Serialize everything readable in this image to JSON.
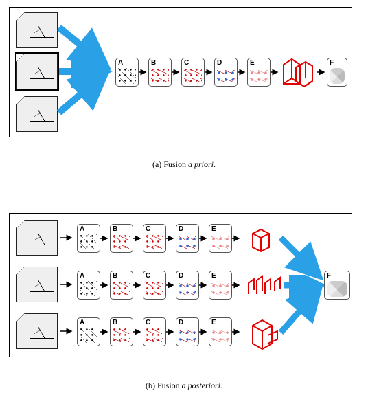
{
  "panelA": {
    "caption_enum": "(a)",
    "caption_plain": "Fusion ",
    "caption_italic": "a priori",
    "caption_end": ".",
    "thumbs": [
      "input-1",
      "input-2",
      "input-3"
    ],
    "stages": {
      "A": "A",
      "B": "B",
      "C": "C",
      "D": "D",
      "E": "E",
      "F": "F"
    }
  },
  "panelB": {
    "caption_enum": "(b)",
    "caption_plain": "Fusion ",
    "caption_italic": "a posteriori",
    "caption_end": ".",
    "rows": 3,
    "stages": {
      "A": "A",
      "B": "B",
      "C": "C",
      "D": "D",
      "E": "E",
      "F": "F"
    }
  },
  "chart_data": {
    "type": "diagram",
    "title": "",
    "subfigures": [
      {
        "label": "(a) Fusion a priori",
        "inputs": 3,
        "fusion_point": "before pipeline (after inputs merge into single A)",
        "pipeline": [
          "A",
          "B",
          "C",
          "D",
          "E",
          "3D-reconstruction",
          "F"
        ],
        "arrows": {
          "input_to_A": {
            "count": 3,
            "color": "blue",
            "style": "thick"
          },
          "stage_to_stage": {
            "color": "black",
            "style": "thin"
          }
        }
      },
      {
        "label": "(b) Fusion a posteriori",
        "inputs": 3,
        "fusion_point": "after per-input 3D-reconstruction (merge into single F)",
        "pipeline_per_input": [
          "A",
          "B",
          "C",
          "D",
          "E",
          "3D-reconstruction"
        ],
        "final_node": "F",
        "arrows": {
          "input_to_A": {
            "count": 3,
            "color": "black",
            "style": "thin"
          },
          "stage_to_stage": {
            "color": "black",
            "style": "thin"
          },
          "reconstruction_to_F": {
            "count": 3,
            "color": "blue",
            "style": "thick"
          }
        }
      }
    ]
  }
}
